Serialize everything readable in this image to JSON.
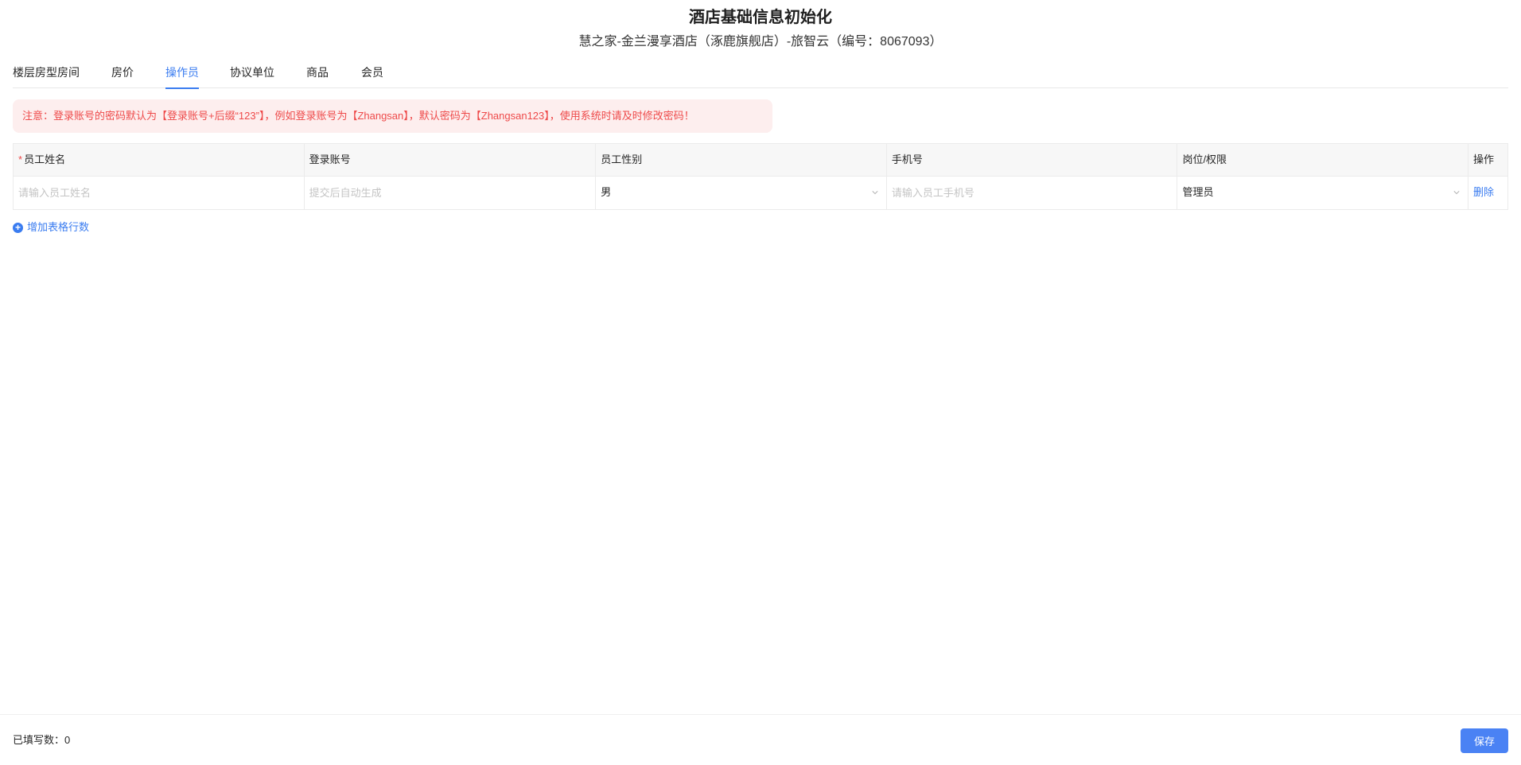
{
  "header": {
    "title": "酒店基础信息初始化",
    "subtitle": "慧之家-金兰漫享酒店（涿鹿旗舰店）-旅智云（编号：8067093）"
  },
  "tabs": [
    {
      "label": "楼层房型房间",
      "active": false
    },
    {
      "label": "房价",
      "active": false
    },
    {
      "label": "操作员",
      "active": true
    },
    {
      "label": "协议单位",
      "active": false
    },
    {
      "label": "商品",
      "active": false
    },
    {
      "label": "会员",
      "active": false
    }
  ],
  "notice": {
    "text": "注意：登录账号的密码默认为【登录账号+后缀“123”】，例如登录账号为【Zhangsan】，默认密码为【Zhangsan123】，使用系统时请及时修改密码！"
  },
  "table": {
    "columns": [
      {
        "label": "员工姓名",
        "required": true
      },
      {
        "label": "登录账号",
        "required": false
      },
      {
        "label": "员工性别",
        "required": false
      },
      {
        "label": "手机号",
        "required": false
      },
      {
        "label": "岗位/权限",
        "required": false
      },
      {
        "label": "操作",
        "required": false
      }
    ],
    "required_mark": "*",
    "rows": [
      {
        "name_placeholder": "请输入员工姓名",
        "account_placeholder": "提交后自动生成",
        "gender": "男",
        "phone_placeholder": "请输入员工手机号",
        "role": "管理员",
        "action": "删除"
      }
    ]
  },
  "add_row": {
    "label": "增加表格行数"
  },
  "footer": {
    "filled_count": "已填写数：0",
    "save_label": "保存"
  },
  "colors": {
    "accent": "#3a7cf0",
    "alert_text": "#ee4a4a",
    "alert_bg": "#fdeeee",
    "save_button": "#4a82f4"
  }
}
